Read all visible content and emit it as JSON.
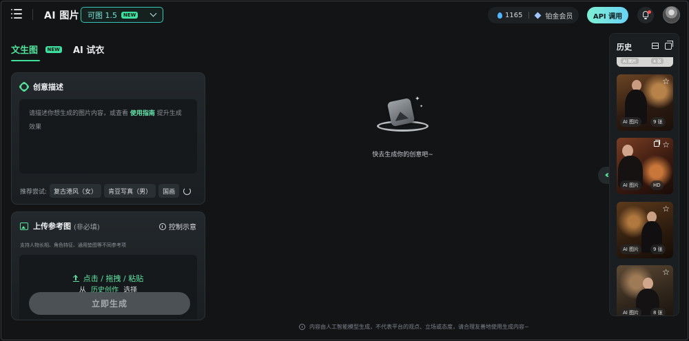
{
  "header": {
    "app_title": "AI 图片",
    "model": {
      "label": "可图 1.5",
      "badge": "NEW"
    },
    "credits": {
      "amount": "1165",
      "membership": "铂金会员"
    },
    "api_button": "API 调用",
    "notification_dot": true
  },
  "tabs": [
    {
      "label": "文生图",
      "badge": "NEW",
      "active": true
    },
    {
      "label": "AI 试衣",
      "active": false
    }
  ],
  "prompt_card": {
    "title": "创意描述",
    "placeholder_before": "请描述你想生成的图片内容，或查看",
    "placeholder_link": "使用指南",
    "placeholder_after": "提升生成效果",
    "suggest_label": "推荐尝试:",
    "suggestions": [
      "复古港风（女）",
      "肯豆写真（男）",
      "国画"
    ]
  },
  "reference_card": {
    "title": "上传参考图",
    "subtitle": "(非必填)",
    "action": "控制示意",
    "description": "支持人物长相、角色特征、通用垫图等不同参考项",
    "upload_text": "点击 / 拖拽 / 粘贴",
    "from_prefix": "从",
    "from_link": "历史创作",
    "from_suffix": "选择"
  },
  "generate_button": "立即生成",
  "empty_state": {
    "text": "快去生成你的创意吧~"
  },
  "footer": {
    "disclaimer": "内容由人工智能模型生成，不代表平台的观点、立场或态度，请合理友善地使用生成内容~"
  },
  "history": {
    "title": "历史",
    "partial_tags": [
      "AI 图片",
      "4 张"
    ],
    "items": [
      {
        "type": "AI 图片",
        "count": "9 张"
      },
      {
        "type": "AI 图片",
        "count": "HD"
      },
      {
        "type": "AI 图片",
        "count": "9 张"
      },
      {
        "type": "AI 图片",
        "count": "8 张"
      }
    ]
  },
  "colors": {
    "accent": "#52e29a",
    "accent_teal": "#35c7b9",
    "background": "#121416",
    "card": "#1e2226"
  }
}
